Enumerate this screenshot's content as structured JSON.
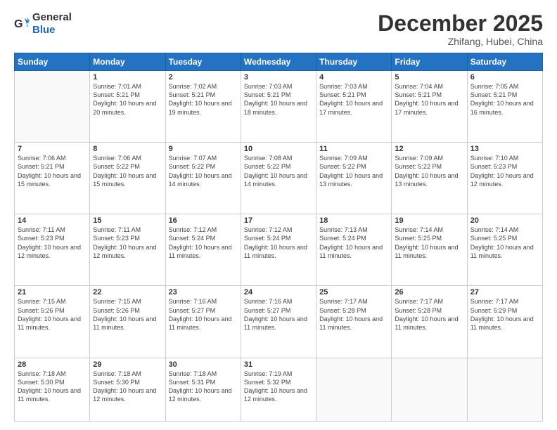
{
  "logo": {
    "general": "General",
    "blue": "Blue"
  },
  "header": {
    "month": "December 2025",
    "location": "Zhifang, Hubei, China"
  },
  "weekdays": [
    "Sunday",
    "Monday",
    "Tuesday",
    "Wednesday",
    "Thursday",
    "Friday",
    "Saturday"
  ],
  "weeks": [
    [
      {
        "day": null
      },
      {
        "day": "1",
        "sunrise": "7:01 AM",
        "sunset": "5:21 PM",
        "daylight": "10 hours and 20 minutes."
      },
      {
        "day": "2",
        "sunrise": "7:02 AM",
        "sunset": "5:21 PM",
        "daylight": "10 hours and 19 minutes."
      },
      {
        "day": "3",
        "sunrise": "7:03 AM",
        "sunset": "5:21 PM",
        "daylight": "10 hours and 18 minutes."
      },
      {
        "day": "4",
        "sunrise": "7:03 AM",
        "sunset": "5:21 PM",
        "daylight": "10 hours and 17 minutes."
      },
      {
        "day": "5",
        "sunrise": "7:04 AM",
        "sunset": "5:21 PM",
        "daylight": "10 hours and 17 minutes."
      },
      {
        "day": "6",
        "sunrise": "7:05 AM",
        "sunset": "5:21 PM",
        "daylight": "10 hours and 16 minutes."
      }
    ],
    [
      {
        "day": "7",
        "sunrise": "7:06 AM",
        "sunset": "5:21 PM",
        "daylight": "10 hours and 15 minutes."
      },
      {
        "day": "8",
        "sunrise": "7:06 AM",
        "sunset": "5:22 PM",
        "daylight": "10 hours and 15 minutes."
      },
      {
        "day": "9",
        "sunrise": "7:07 AM",
        "sunset": "5:22 PM",
        "daylight": "10 hours and 14 minutes."
      },
      {
        "day": "10",
        "sunrise": "7:08 AM",
        "sunset": "5:22 PM",
        "daylight": "10 hours and 14 minutes."
      },
      {
        "day": "11",
        "sunrise": "7:09 AM",
        "sunset": "5:22 PM",
        "daylight": "10 hours and 13 minutes."
      },
      {
        "day": "12",
        "sunrise": "7:09 AM",
        "sunset": "5:22 PM",
        "daylight": "10 hours and 13 minutes."
      },
      {
        "day": "13",
        "sunrise": "7:10 AM",
        "sunset": "5:23 PM",
        "daylight": "10 hours and 12 minutes."
      }
    ],
    [
      {
        "day": "14",
        "sunrise": "7:11 AM",
        "sunset": "5:23 PM",
        "daylight": "10 hours and 12 minutes."
      },
      {
        "day": "15",
        "sunrise": "7:11 AM",
        "sunset": "5:23 PM",
        "daylight": "10 hours and 12 minutes."
      },
      {
        "day": "16",
        "sunrise": "7:12 AM",
        "sunset": "5:24 PM",
        "daylight": "10 hours and 11 minutes."
      },
      {
        "day": "17",
        "sunrise": "7:12 AM",
        "sunset": "5:24 PM",
        "daylight": "10 hours and 11 minutes."
      },
      {
        "day": "18",
        "sunrise": "7:13 AM",
        "sunset": "5:24 PM",
        "daylight": "10 hours and 11 minutes."
      },
      {
        "day": "19",
        "sunrise": "7:14 AM",
        "sunset": "5:25 PM",
        "daylight": "10 hours and 11 minutes."
      },
      {
        "day": "20",
        "sunrise": "7:14 AM",
        "sunset": "5:25 PM",
        "daylight": "10 hours and 11 minutes."
      }
    ],
    [
      {
        "day": "21",
        "sunrise": "7:15 AM",
        "sunset": "5:26 PM",
        "daylight": "10 hours and 11 minutes."
      },
      {
        "day": "22",
        "sunrise": "7:15 AM",
        "sunset": "5:26 PM",
        "daylight": "10 hours and 11 minutes."
      },
      {
        "day": "23",
        "sunrise": "7:16 AM",
        "sunset": "5:27 PM",
        "daylight": "10 hours and 11 minutes."
      },
      {
        "day": "24",
        "sunrise": "7:16 AM",
        "sunset": "5:27 PM",
        "daylight": "10 hours and 11 minutes."
      },
      {
        "day": "25",
        "sunrise": "7:17 AM",
        "sunset": "5:28 PM",
        "daylight": "10 hours and 11 minutes."
      },
      {
        "day": "26",
        "sunrise": "7:17 AM",
        "sunset": "5:28 PM",
        "daylight": "10 hours and 11 minutes."
      },
      {
        "day": "27",
        "sunrise": "7:17 AM",
        "sunset": "5:29 PM",
        "daylight": "10 hours and 11 minutes."
      }
    ],
    [
      {
        "day": "28",
        "sunrise": "7:18 AM",
        "sunset": "5:30 PM",
        "daylight": "10 hours and 11 minutes."
      },
      {
        "day": "29",
        "sunrise": "7:18 AM",
        "sunset": "5:30 PM",
        "daylight": "10 hours and 12 minutes."
      },
      {
        "day": "30",
        "sunrise": "7:18 AM",
        "sunset": "5:31 PM",
        "daylight": "10 hours and 12 minutes."
      },
      {
        "day": "31",
        "sunrise": "7:19 AM",
        "sunset": "5:32 PM",
        "daylight": "10 hours and 12 minutes."
      },
      {
        "day": null
      },
      {
        "day": null
      },
      {
        "day": null
      }
    ]
  ],
  "labels": {
    "sunrise": "Sunrise:",
    "sunset": "Sunset:",
    "daylight": "Daylight:"
  }
}
